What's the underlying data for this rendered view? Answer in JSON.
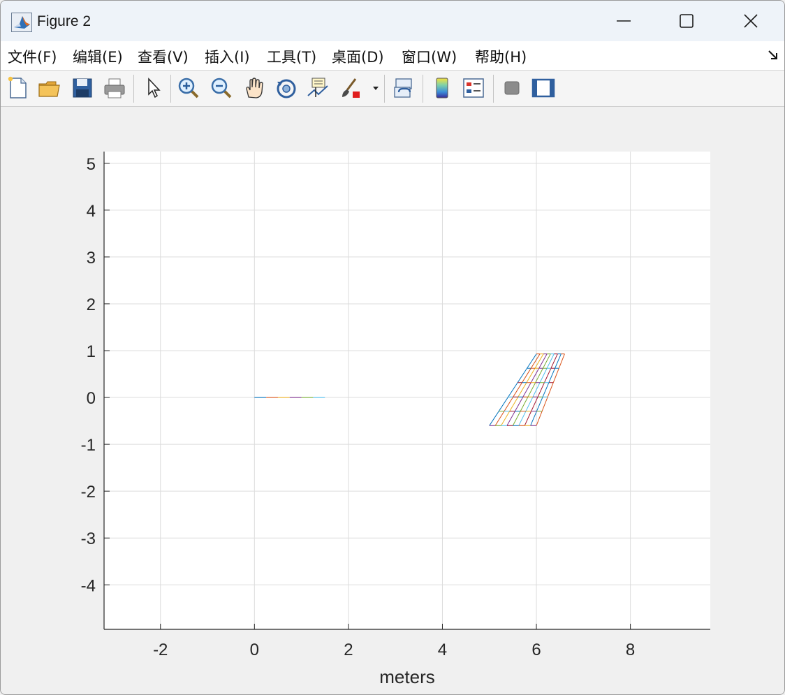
{
  "window": {
    "title": "Figure 2",
    "icon": "matlab-icon",
    "controls": [
      "minimize-icon",
      "maximize-icon",
      "close-icon"
    ]
  },
  "menu": {
    "items": [
      "文件(F)",
      "编辑(E)",
      "查看(V)",
      "插入(I)",
      "工具(T)",
      "桌面(D)",
      "窗口(W)",
      "帮助(H)"
    ],
    "overflow_icon": "dock-arrow-icon"
  },
  "toolbar": {
    "buttons": [
      "new-figure-icon",
      "open-file-icon",
      "save-icon",
      "print-icon",
      "edit-plot-pointer-icon",
      "zoom-in-icon",
      "zoom-out-icon",
      "pan-hand-icon",
      "rotate-3d-icon",
      "data-cursor-icon",
      "brush-icon",
      "link-plot-icon",
      "colorbar-icon",
      "legend-icon",
      "hide-plot-tools-icon",
      "show-plot-tools-icon"
    ]
  },
  "chart_data": {
    "type": "line",
    "title": "",
    "xlabel": "meters",
    "ylabel": "",
    "xlim": [
      -3.2,
      9.7
    ],
    "ylim": [
      -4.95,
      5.25
    ],
    "xticks": [
      "-2",
      "0",
      "2",
      "4",
      "6",
      "8"
    ],
    "yticks": [
      "5",
      "4",
      "3",
      "2",
      "1",
      "0",
      "-1",
      "-2",
      "-3",
      "-4"
    ],
    "grid": true,
    "colors": [
      "#0072BD",
      "#D95319",
      "#EDB120",
      "#7E2F8E",
      "#77AC30",
      "#4DBEEE",
      "#A2142F"
    ],
    "segment_near_origin": {
      "x": [
        0,
        1.5
      ],
      "y": [
        0,
        0
      ]
    },
    "mesh": {
      "bottom_edge": {
        "x": [
          5.0,
          6.0
        ],
        "y": -0.6
      },
      "top_edge": {
        "x": [
          6.0,
          6.6
        ],
        "y": 0.93
      },
      "columns": 8,
      "rows": 5
    }
  }
}
